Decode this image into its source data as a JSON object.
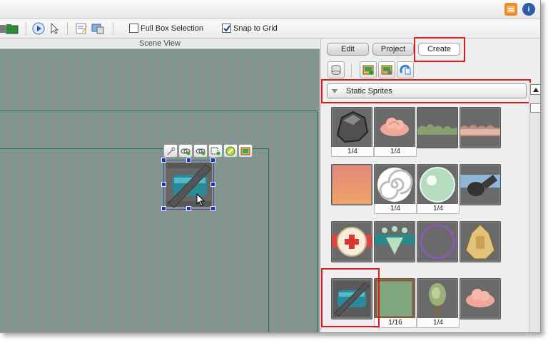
{
  "toolbar": {
    "full_box_selection": {
      "label": "Full Box Selection",
      "checked": false
    },
    "snap_to_grid": {
      "label": "Snap to Grid",
      "checked": true
    }
  },
  "scene": {
    "title": "Scene View"
  },
  "panel": {
    "tabs": [
      {
        "label": "Edit",
        "active": false
      },
      {
        "label": "Project",
        "active": false
      },
      {
        "label": "Create",
        "active": true
      }
    ],
    "dropdown": {
      "label": "Static Sprites",
      "icon": "triangle-down"
    },
    "sprites": [
      {
        "name": "rock",
        "caption": "1/4"
      },
      {
        "name": "pink-cloud",
        "caption": "1/4"
      },
      {
        "name": "hills-green",
        "caption": ""
      },
      {
        "name": "hills-pink",
        "caption": ""
      },
      {
        "name": "gradient-sky",
        "caption": ""
      },
      {
        "name": "spiral",
        "caption": "1/4"
      },
      {
        "name": "green-orb",
        "caption": "1/4"
      },
      {
        "name": "bomb",
        "caption": ""
      },
      {
        "name": "health-cross",
        "caption": ""
      },
      {
        "name": "crown-banner",
        "caption": ""
      },
      {
        "name": "purple-ring",
        "caption": ""
      },
      {
        "name": "gold-ship",
        "caption": ""
      },
      {
        "name": "crate",
        "caption": ""
      },
      {
        "name": "green-panel",
        "caption": "1/16"
      },
      {
        "name": "tree",
        "caption": "1/4"
      },
      {
        "name": "pink-cloud-2",
        "caption": ""
      }
    ]
  },
  "colors": {
    "highlight": "#e0191f",
    "grid_line": "#3caa96",
    "scene_bg": "#8f9090"
  }
}
